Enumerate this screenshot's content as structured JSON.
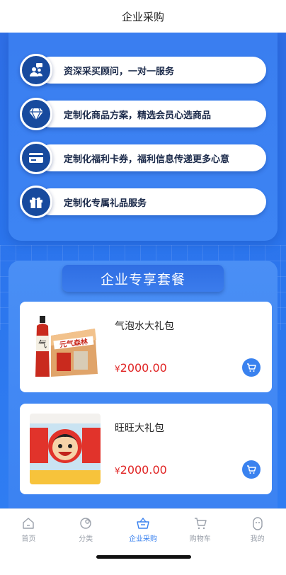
{
  "header": {
    "title": "企业采购"
  },
  "services": [
    {
      "label": "资深采买顾问，一对一服务",
      "icon": "consultant-icon"
    },
    {
      "label": "定制化商品方案，精选会员心选商品",
      "icon": "diamond-icon"
    },
    {
      "label": "定制化福利卡券，福利信息传递更多心意",
      "icon": "card-icon"
    },
    {
      "label": "定制化专属礼品服务",
      "icon": "gift-icon"
    }
  ],
  "packages": {
    "title": "企业专享套餐",
    "items": [
      {
        "name": "气泡水大礼包",
        "currency": "¥",
        "price": "2000.00",
        "image_text": "元气森林"
      },
      {
        "name": "旺旺大礼包",
        "currency": "¥",
        "price": "2000.00"
      }
    ]
  },
  "tabs": [
    {
      "label": "首页",
      "icon": "home-icon",
      "active": false
    },
    {
      "label": "分类",
      "icon": "category-icon",
      "active": false
    },
    {
      "label": "企业采购",
      "icon": "basket-icon",
      "active": true
    },
    {
      "label": "购物车",
      "icon": "cart-icon",
      "active": false
    },
    {
      "label": "我的",
      "icon": "profile-icon",
      "active": false
    }
  ],
  "colors": {
    "primary": "#3a82ef",
    "price": "#e02424",
    "hero": "#2f6fe6"
  }
}
